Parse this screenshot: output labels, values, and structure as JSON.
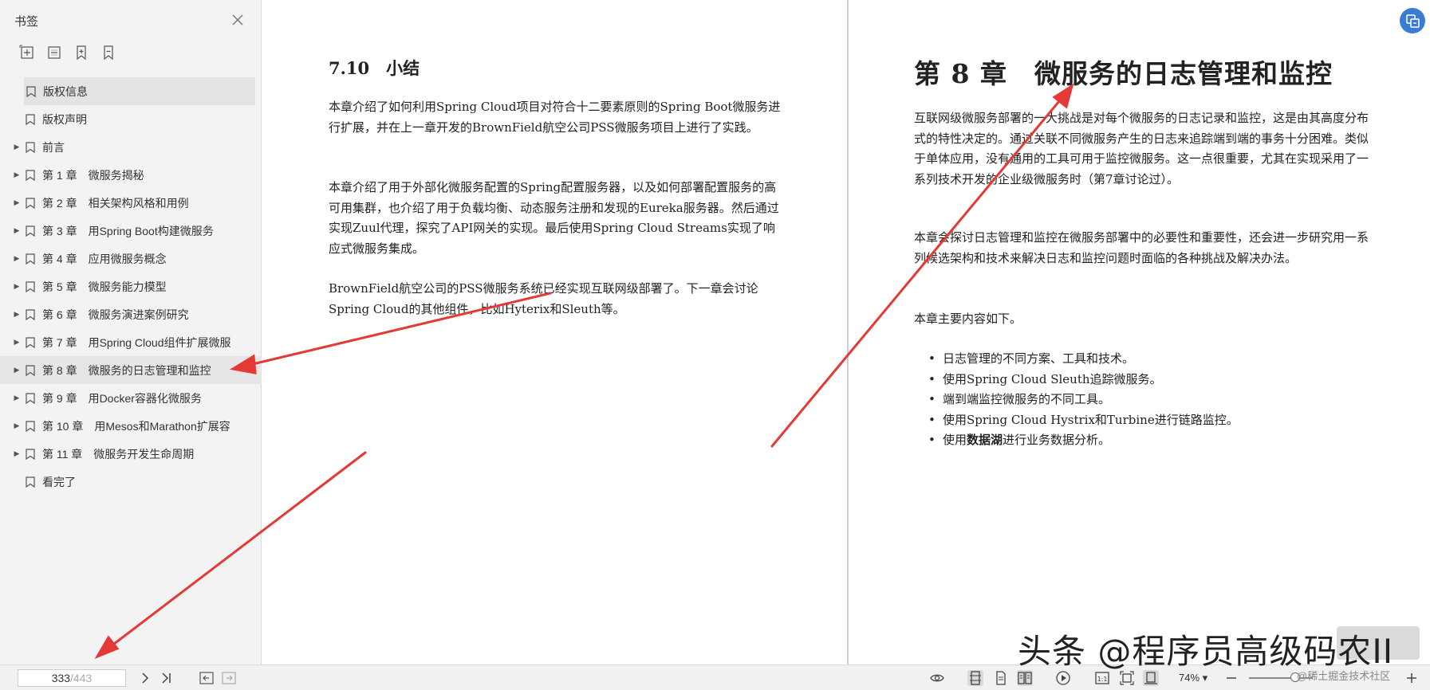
{
  "sidebar": {
    "title": "书签",
    "items": [
      {
        "label": "版权信息",
        "expandable": false,
        "selected": true
      },
      {
        "label": "版权声明",
        "expandable": false
      },
      {
        "label": "前言",
        "expandable": true
      },
      {
        "label": "第 1 章　微服务揭秘",
        "expandable": true
      },
      {
        "label": "第 2 章　相关架构风格和用例",
        "expandable": true
      },
      {
        "label": "第 3 章　用Spring Boot构建微服务",
        "expandable": true
      },
      {
        "label": "第 4 章　应用微服务概念",
        "expandable": true
      },
      {
        "label": "第 5 章　微服务能力模型",
        "expandable": true
      },
      {
        "label": "第 6 章　微服务演进案例研究",
        "expandable": true
      },
      {
        "label": "第 7 章　用Spring Cloud组件扩展微服",
        "expandable": true
      },
      {
        "label": "第 8 章　微服务的日志管理和监控",
        "expandable": true,
        "active": true
      },
      {
        "label": "第 9 章　用Docker容器化微服务",
        "expandable": true
      },
      {
        "label": "第 10 章　用Mesos和Marathon扩展容",
        "expandable": true
      },
      {
        "label": "第 11 章　微服务开发生命周期",
        "expandable": true
      },
      {
        "label": "看完了",
        "expandable": false
      }
    ]
  },
  "left_page": {
    "section_title": "7.10　小结",
    "paragraphs": [
      "本章介绍了如何利用Spring Cloud项目对符合十二要素原则的Spring Boot微服务进行扩展，并在上一章开发的BrownField航空公司PSS微服务项目上进行了实践。",
      "本章介绍了用于外部化微服务配置的Spring配置服务器，以及如何部署配置服务的高可用集群，也介绍了用于负载均衡、动态服务注册和发现的Eureka服务器。然后通过实现Zuul代理，探究了API网关的实现。最后使用Spring Cloud Streams实现了响应式微服务集成。",
      "BrownField航空公司的PSS微服务系统已经实现互联网级部署了。下一章会讨论Spring Cloud的其他组件，比如Hyterix和Sleuth等。"
    ]
  },
  "right_page": {
    "chapter_title": "第 8 章　微服务的日志管理和监控",
    "paragraphs": [
      "互联网级微服务部署的一大挑战是对每个微服务的日志记录和监控，这是由其高度分布式的特性决定的。通过关联不同微服务产生的日志来追踪端到端的事务十分困难。类似于单体应用，没有通用的工具可用于监控微服务。这一点很重要，尤其在实现采用了一系列技术开发的企业级微服务时（第7章讨论过）。",
      "本章会探讨日志管理和监控在微服务部署中的必要性和重要性，还会进一步研究用一系列候选架构和技术来解决日志和监控问题时面临的各种挑战及解决办法。",
      "本章主要内容如下。"
    ],
    "bullets": [
      {
        "pre": "日志管理的不同方案、工具和技术。"
      },
      {
        "pre": "使用Spring Cloud Sleuth追踪微服务。"
      },
      {
        "pre": "端到端监控微服务的不同工具。"
      },
      {
        "pre": "使用Spring Cloud Hystrix和Turbine进行链路监控。"
      },
      {
        "pre": "使用",
        "bold": "数据湖",
        "post": "进行业务数据分析。"
      }
    ]
  },
  "bottom_bar": {
    "current_page": "333",
    "total_pages": "/443",
    "zoom": "74% ▾"
  },
  "watermark": {
    "main": "头条 @程序员高级码农II",
    "sub": "@稀土掘金技术社区"
  },
  "colors": {
    "arrow": "#e53935",
    "accent": "#3a7bd5"
  },
  "icons": [
    "close-icon",
    "expand-all-icon",
    "collapse-all-icon",
    "add-bookmark-icon",
    "bookmark-icon",
    "next-page-icon",
    "last-page-icon",
    "back-icon",
    "forward-icon",
    "eye-icon",
    "single-page-icon",
    "continuous-page-icon",
    "double-page-icon",
    "play-icon",
    "actual-size-icon",
    "fit-page-icon",
    "fit-width-icon",
    "zoom-out-icon",
    "zoom-in-icon",
    "translate-icon"
  ]
}
